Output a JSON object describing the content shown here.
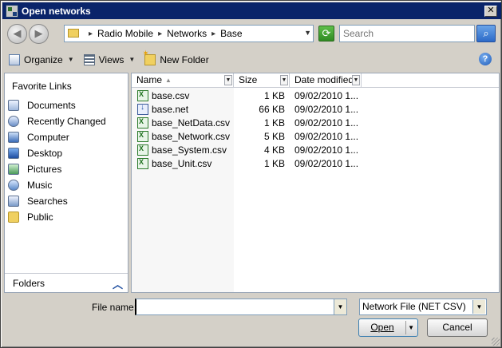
{
  "titlebar": {
    "title": "Open networks",
    "close_glyph": "✕"
  },
  "navbar": {
    "back_glyph": "◀",
    "forward_glyph": "▶",
    "breadcrumb": [
      "Radio Mobile",
      "Networks",
      "Base"
    ],
    "breadcrumb_sep": "▸",
    "search_placeholder": "Search"
  },
  "toolbar": {
    "organize": "Organize",
    "views": "Views",
    "new_folder": "New Folder",
    "help_glyph": "?"
  },
  "navpane": {
    "title": "Favorite Links",
    "items": [
      {
        "label": "Documents",
        "icon": "documents-icon"
      },
      {
        "label": "Recently Changed",
        "icon": "recently-changed-icon"
      },
      {
        "label": "Computer",
        "icon": "computer-icon"
      },
      {
        "label": "Desktop",
        "icon": "desktop-icon"
      },
      {
        "label": "Pictures",
        "icon": "pictures-icon"
      },
      {
        "label": "Music",
        "icon": "music-icon"
      },
      {
        "label": "Searches",
        "icon": "searches-icon"
      },
      {
        "label": "Public",
        "icon": "public-folder-icon"
      }
    ],
    "folders_label": "Folders"
  },
  "filelist": {
    "columns": {
      "name": "Name",
      "size": "Size",
      "date": "Date modified"
    },
    "files": [
      {
        "name": "base.csv",
        "size": "1 KB",
        "date": "09/02/2010 1...",
        "type": "csv"
      },
      {
        "name": "base.net",
        "size": "66 KB",
        "date": "09/02/2010 1...",
        "type": "net"
      },
      {
        "name": "base_NetData.csv",
        "size": "1 KB",
        "date": "09/02/2010 1...",
        "type": "csv"
      },
      {
        "name": "base_Network.csv",
        "size": "5 KB",
        "date": "09/02/2010 1...",
        "type": "csv"
      },
      {
        "name": "base_System.csv",
        "size": "4 KB",
        "date": "09/02/2010 1...",
        "type": "csv"
      },
      {
        "name": "base_Unit.csv",
        "size": "1 KB",
        "date": "09/02/2010 1...",
        "type": "csv"
      }
    ]
  },
  "footer": {
    "filename_label": "File name:",
    "filename_value": "",
    "filetype_value": "Network File (NET CSV)",
    "open_label": "Open",
    "cancel_label": "Cancel"
  },
  "colors": {
    "titlebar": "#0a246a",
    "face": "#d4d0c8",
    "accent": "#3c7fb1"
  }
}
